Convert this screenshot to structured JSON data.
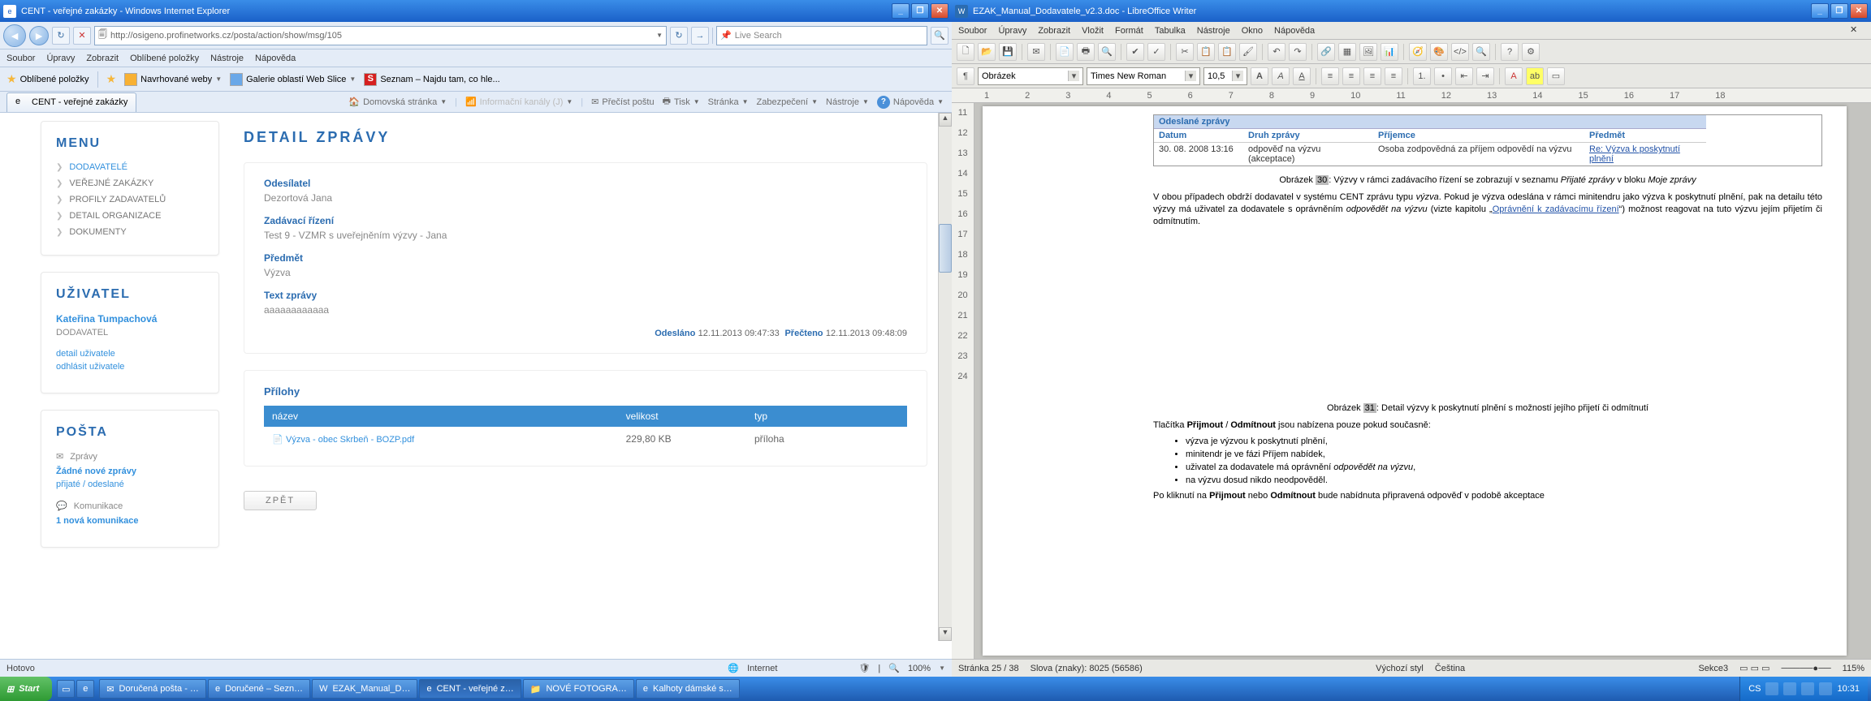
{
  "left": {
    "title": "CENT - veřejné zakázky - Windows Internet Explorer",
    "url": "http://osigeno.profinetworks.cz/posta/action/show/msg/105",
    "searchPlaceholder": "Live Search",
    "menubar": [
      "Soubor",
      "Úpravy",
      "Zobrazit",
      "Oblíbené položky",
      "Nástroje",
      "Nápověda"
    ],
    "favLabel": "Oblíbené položky",
    "favLinks": [
      "Navrhované weby",
      "Galerie oblastí Web Slice",
      "Seznam – Najdu tam, co hle..."
    ],
    "tab": "CENT - veřejné zakázky",
    "cmd": {
      "home": "Domovská stránka",
      "feeds": "Informační kanály (J)",
      "mail": "Přečíst poštu",
      "print": "Tisk",
      "page": "Stránka",
      "safety": "Zabezpečení",
      "tools": "Nástroje",
      "help": "Nápověda"
    },
    "status": {
      "done": "Hotovo",
      "zone": "Internet",
      "zoom": "100%"
    }
  },
  "page": {
    "menuTitle": "MENU",
    "menu": [
      {
        "l": "DODAVATELÉ",
        "a": true
      },
      {
        "l": "VEŘEJNÉ ZAKÁZKY"
      },
      {
        "l": "PROFILY ZADAVATELŮ"
      },
      {
        "l": "DETAIL ORGANIZACE"
      },
      {
        "l": "DOKUMENTY"
      }
    ],
    "userTitle": "UŽIVATEL",
    "userName": "Kateřina Tumpachová",
    "userRole": "DODAVATEL",
    "detailLink": "detail uživatele",
    "logoutLink": "odhlásit uživatele",
    "postaTitle": "POŠTA",
    "zpravy": "Zprávy",
    "nonew": "Žádné nové zprávy",
    "inout": "přijaté / odeslané",
    "kom": "Komunikace",
    "newkom": "1 nová komunikace",
    "detailTitle": "DETAIL ZPRÁVY",
    "fields": {
      "odesL": "Odesílatel",
      "odesV": "Dezortová Jana",
      "zadL": "Zadávací řízení",
      "zadV": "Test 9 - VZMR s uveřejněním výzvy - Jana",
      "predL": "Předmět",
      "predV": "Výzva",
      "textL": "Text zprávy",
      "textV": "aaaaaaaaaaaa"
    },
    "ts": {
      "sent": "Odesláno",
      "sentV": "12.11.2013 09:47:33",
      "read": "Přečteno",
      "readV": "12.11.2013 09:48:09"
    },
    "att": {
      "title": "Přílohy",
      "hName": "název",
      "hSize": "velikost",
      "hType": "typ",
      "file": "Výzva - obec Skrbeň - BOZP.pdf",
      "size": "229,80 KB",
      "type": "příloha"
    },
    "back": "ZPĚT"
  },
  "right": {
    "title": "EZAK_Manual_Dodavatele_v2.3.doc - LibreOffice Writer",
    "menubar": [
      "Soubor",
      "Úpravy",
      "Zobrazit",
      "Vložit",
      "Formát",
      "Tabulka",
      "Nástroje",
      "Okno",
      "Nápověda"
    ],
    "styleCombo": "Obrázek",
    "fontCombo": "Times New Roman",
    "sizeCombo": "10,5",
    "ruler": [
      "1",
      "2",
      "3",
      "4",
      "5",
      "6",
      "7",
      "8",
      "9",
      "10",
      "11",
      "12",
      "13",
      "14",
      "15",
      "16",
      "17",
      "18"
    ],
    "vruler": [
      "11",
      "12",
      "13",
      "14",
      "15",
      "16",
      "17",
      "18",
      "19",
      "20",
      "21",
      "22",
      "23",
      "24"
    ],
    "doc": {
      "tblTitle": "Odeslané zprávy",
      "th": [
        "Datum",
        "Druh zprávy",
        "Příjemce",
        "Předmět"
      ],
      "tr": [
        "30. 08. 2008 13:16",
        "odpověď na výzvu (akceptace)",
        "Osoba zodpovědná za příjem odpovědí na výzvu",
        "Re: Výzva k poskytnutí plnění"
      ],
      "cap1a": "Obrázek ",
      "cap1n": "30",
      "cap1b": ": Výzvy v rámci zadávacího řízení se zobrazují v seznamu ",
      "cap1c": "Přijaté zprávy",
      "cap1d": " v bloku ",
      "cap1e": "Moje zprávy",
      "p1": "V obou případech obdrží dodavatel v systému CENT zprávu typu ",
      "p1i": "výzva",
      "p1b": ". Pokud je výzva odeslána v rámci minitendru jako výzva k poskytnutí plnění, pak na detailu této výzvy má uživatel za dodavatele s oprávněním ",
      "p1c": "odpovědět na výzvu",
      "p1d": " (vizte kapitolu „",
      "p1link": "Oprávnění k zadávacímu řízení",
      "p1e": "“) možnost reagovat na tuto výzvu jejím přijetím či odmítnutím.",
      "cap2a": "Obrázek ",
      "cap2n": "31",
      "cap2b": ": Detail výzvy k poskytnutí plnění s možností jejího přijetí či odmítnutí",
      "p2a": "Tlačítka ",
      "p2b": "Přijmout",
      "p2c": " / ",
      "p2d": "Odmítnout",
      "p2e": " jsou nabízena pouze pokud současně:",
      "li1": "výzva je výzvou k poskytnutí plnění,",
      "li2": "minitendr je ve fázi Příjem nabídek,",
      "li3a": "uživatel za dodavatele má oprávnění ",
      "li3b": "odpovědět na výzvu",
      "li3c": ",",
      "li4": "na výzvu dosud nikdo neodpověděl.",
      "p3a": "Po kliknutí na ",
      "p3b": "Přijmout",
      "p3c": " nebo ",
      "p3d": "Odmítnout",
      "p3e": " bude nabídnuta připravená odpověď v podobě akceptace"
    },
    "status": {
      "page": "Stránka 25 / 38",
      "words": "Slova (znaky): 8025 (56586)",
      "style": "Výchozí styl",
      "lang": "Čeština",
      "sec": "Sekce3",
      "zoom": "115%"
    }
  },
  "taskbar": {
    "start": "Start",
    "items": [
      "Doručená pošta - …",
      "Doručené – Sezn…",
      "EZAK_Manual_D…",
      "CENT - veřejné z…",
      "NOVÉ FOTOGRA…",
      "Kalhoty dámské s…"
    ],
    "lang": "CS",
    "time": "10:31"
  }
}
